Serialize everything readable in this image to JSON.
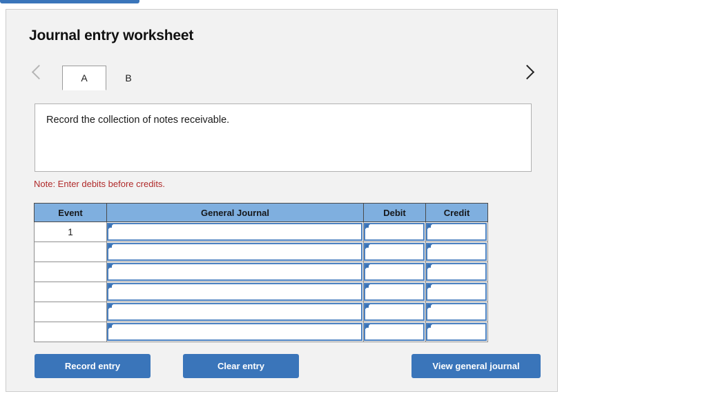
{
  "top_cut_button": {
    "label": ""
  },
  "panel": {
    "title": "Journal entry worksheet",
    "nav": {
      "prev_icon": "chevron-left-icon",
      "next_icon": "chevron-right-icon"
    },
    "tabs": [
      {
        "label": "A",
        "active": true
      },
      {
        "label": "B",
        "active": false
      }
    ],
    "description": "Record the collection of notes receivable.",
    "note": "Note: Enter debits before credits."
  },
  "table": {
    "headers": [
      "Event",
      "General Journal",
      "Debit",
      "Credit"
    ],
    "rows": [
      {
        "event": "1",
        "general_journal": "",
        "debit": "",
        "credit": ""
      },
      {
        "event": "",
        "general_journal": "",
        "debit": "",
        "credit": ""
      },
      {
        "event": "",
        "general_journal": "",
        "debit": "",
        "credit": ""
      },
      {
        "event": "",
        "general_journal": "",
        "debit": "",
        "credit": ""
      },
      {
        "event": "",
        "general_journal": "",
        "debit": "",
        "credit": ""
      },
      {
        "event": "",
        "general_journal": "",
        "debit": "",
        "credit": ""
      }
    ]
  },
  "buttons": {
    "record_entry": "Record entry",
    "clear_entry": "Clear entry",
    "view_general_journal": "View general journal"
  },
  "colors": {
    "accent_blue": "#3a75ba",
    "header_blue": "#7fafdf",
    "field_border_blue": "#4a80c0",
    "note_red": "#b02a2a",
    "panel_bg": "#f2f2f2"
  }
}
